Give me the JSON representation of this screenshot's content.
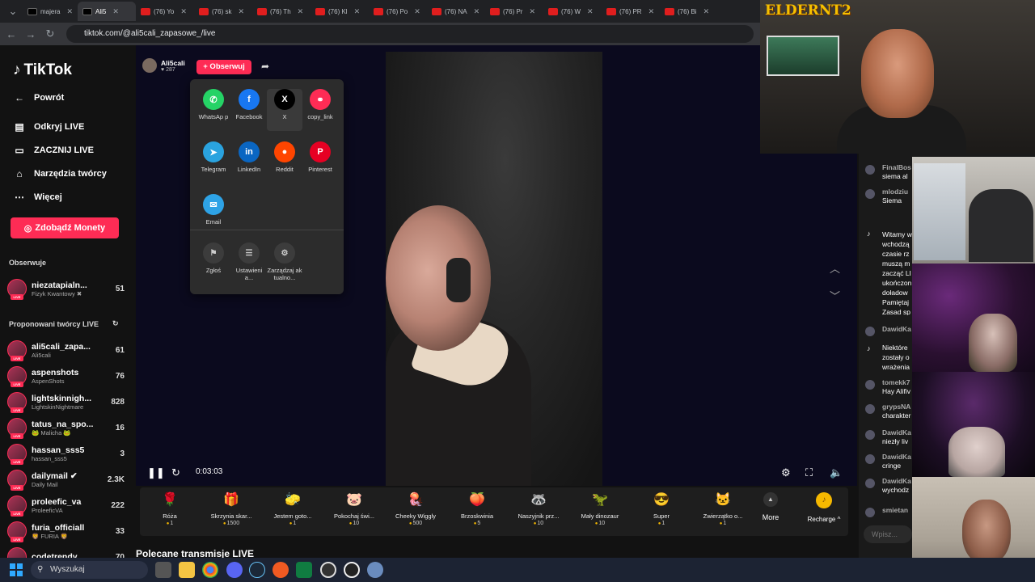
{
  "tabs": [
    {
      "title": "majera",
      "icon": "tiktok-icon"
    },
    {
      "title": "Ali5",
      "icon": "tiktok-icon",
      "active": true
    },
    {
      "title": "(76) Yo",
      "icon": "youtube-icon"
    },
    {
      "title": "(76) sk",
      "icon": "youtube-icon"
    },
    {
      "title": "(76) Th",
      "icon": "youtube-icon"
    },
    {
      "title": "(76) Kl",
      "icon": "youtube-icon"
    },
    {
      "title": "(76) Po",
      "icon": "youtube-icon"
    },
    {
      "title": "(76) NA",
      "icon": "youtube-icon"
    },
    {
      "title": "(76) Pr",
      "icon": "youtube-icon"
    },
    {
      "title": "(76) W",
      "icon": "youtube-icon"
    },
    {
      "title": "(76) PR",
      "icon": "youtube-icon"
    },
    {
      "title": "(76) Bi",
      "icon": "youtube-icon"
    }
  ],
  "address": {
    "url": "tiktok.com/@ali5cali_zapasowe_/live"
  },
  "sidebar": {
    "logo": "TikTok",
    "back": "Powrót",
    "links": [
      {
        "label": "Odkryj LIVE",
        "icon": "live-icon"
      },
      {
        "label": "ZACZNIJ LIVE",
        "icon": "camera-icon"
      },
      {
        "label": "Narzędzia twórcy",
        "icon": "home-icon"
      },
      {
        "label": "Więcej",
        "icon": "more-icon"
      }
    ],
    "coins_button": "Zdobądź Monety",
    "following_title": "Obserwuje",
    "following": [
      {
        "name": "niezatapialn...",
        "sub": "Fizyk Kwantowy ✖",
        "count": "51"
      }
    ],
    "suggested_title": "Proponowani twórcy LIVE",
    "suggested": [
      {
        "name": "ali5cali_zapa...",
        "sub": "Ali5cali",
        "count": "61"
      },
      {
        "name": "aspenshots",
        "sub": "AspenShots",
        "count": "76"
      },
      {
        "name": "lightskinnigh...",
        "sub": "LightskinNightmare",
        "count": "828"
      },
      {
        "name": "tatus_na_spo...",
        "sub": "🐸 Malicha 🐸",
        "count": "16"
      },
      {
        "name": "hassan_sss5",
        "sub": "hassan_sss5",
        "count": "3"
      },
      {
        "name": "dailymail ✔",
        "sub": "Daily Mail",
        "count": "2.3K"
      },
      {
        "name": "proleefic_va",
        "sub": "ProleeficVA",
        "count": "222"
      },
      {
        "name": "furia_officiall",
        "sub": "🦁 FURIA 🦁",
        "count": "33"
      },
      {
        "name": "codetrendy",
        "sub": "",
        "count": "70"
      }
    ]
  },
  "stream": {
    "streamer_name": "Ali5cali",
    "viewers": "♥ 287",
    "follow": "+ Obserwuj",
    "time": "0:03:03",
    "recommended": "Polecane transmisje LIVE"
  },
  "share": {
    "items": [
      {
        "label": "WhatsAp p",
        "icon": "whatsapp-icon",
        "color": "#25d366",
        "glyph": "✆"
      },
      {
        "label": "Facebook",
        "icon": "facebook-icon",
        "color": "#1877f2",
        "glyph": "f"
      },
      {
        "label": "X",
        "icon": "x-icon",
        "color": "#000000",
        "glyph": "X"
      },
      {
        "label": "copy_link",
        "icon": "link-icon",
        "color": "#fe2c55",
        "glyph": "⚭"
      },
      {
        "label": "Telegram",
        "icon": "telegram-icon",
        "color": "#2aa3df",
        "glyph": "➤"
      },
      {
        "label": "LinkedIn",
        "icon": "linkedin-icon",
        "color": "#0a66c2",
        "glyph": "in"
      },
      {
        "label": "Reddit",
        "icon": "reddit-icon",
        "color": "#ff4500",
        "glyph": "●"
      },
      {
        "label": "Pinterest",
        "icon": "pinterest-icon",
        "color": "#e60023",
        "glyph": "P"
      },
      {
        "label": "Email",
        "icon": "email-icon",
        "color": "#2ea3e6",
        "glyph": "✉"
      }
    ],
    "actions": [
      {
        "label": "Zgłoś",
        "icon": "flag-icon",
        "glyph": "⚑"
      },
      {
        "label": "Ustawieni a...",
        "icon": "settings-icon",
        "glyph": "☰"
      },
      {
        "label": "Zarządzaj aktualno...",
        "icon": "manage-icon",
        "glyph": "⚙"
      }
    ]
  },
  "gifts": [
    {
      "name": "Róża",
      "price": "1",
      "glyph": "🌹"
    },
    {
      "name": "Skrzynia skar...",
      "price": "1500",
      "glyph": "🎁"
    },
    {
      "name": "Jestem goto...",
      "price": "1",
      "glyph": "🧽"
    },
    {
      "name": "Pokochaj świ...",
      "price": "10",
      "glyph": "🐷"
    },
    {
      "name": "Cheeky Wiggly",
      "price": "500",
      "glyph": "🪼"
    },
    {
      "name": "Brzoskwinia",
      "price": "5",
      "glyph": "🍑"
    },
    {
      "name": "Naszyjnik prz...",
      "price": "10",
      "glyph": "🦝"
    },
    {
      "name": "Mały dinozaur",
      "price": "10",
      "glyph": "🦖"
    },
    {
      "name": "Super",
      "price": "1",
      "glyph": "😎"
    },
    {
      "name": "Zwierzątko o...",
      "price": "1",
      "glyph": "🐱"
    }
  ],
  "gift_bar": {
    "more": "More",
    "recharge": "Recharge ^"
  },
  "chat": {
    "messages": [
      {
        "user": "FinalBos",
        "text": "siema al"
      },
      {
        "user": "mlodziu",
        "text": "Siema"
      },
      {
        "user": "DawidKa",
        "text": ""
      },
      {
        "user": "tomekk7",
        "text": "Hay Alifiv"
      },
      {
        "user": "grypsNA",
        "text": "charakter"
      },
      {
        "user": "DawidKa",
        "text": "niezły liv"
      },
      {
        "user": "DawidKa",
        "text": "cringe"
      },
      {
        "user": "DawidKa",
        "text": "wychodz"
      },
      {
        "user": "smietan",
        "text": ""
      }
    ],
    "system1": "Witamy w wchodzą czasie rz muszą m zacząć LI ukończon doładow Pamiętaj Zasad sp",
    "system2": "Niektóre zostały o wrażenia",
    "input_placeholder": "Wpisz..."
  },
  "overlay": {
    "brand": "ELDERNT2"
  },
  "taskbar": {
    "search": "Wyszukaj"
  }
}
